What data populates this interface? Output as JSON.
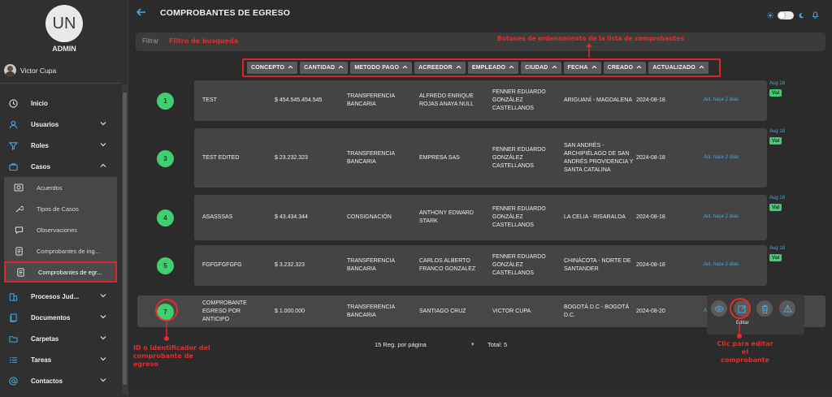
{
  "sidebar": {
    "avatar_initials": "UN",
    "role": "ADMIN",
    "user_name": "Victor Cupa",
    "items": [
      {
        "label": "Inicio"
      },
      {
        "label": "Usuarios"
      },
      {
        "label": "Roles"
      },
      {
        "label": "Casos"
      },
      {
        "label": "Procesos Jud..."
      },
      {
        "label": "Documentos"
      },
      {
        "label": "Carpetas"
      },
      {
        "label": "Tareas"
      },
      {
        "label": "Contactos"
      }
    ],
    "sub_items": [
      {
        "label": "Acuerdos"
      },
      {
        "label": "Tipos de Casos"
      },
      {
        "label": "Observaciones"
      },
      {
        "label": "Comprobantes de ing..."
      },
      {
        "label": "Comprobantes de egr..."
      }
    ]
  },
  "header": {
    "title": "COMPROBANTES DE EGRESO"
  },
  "filter": {
    "label": "Filtrar"
  },
  "annotations": {
    "filter": "Filtro de busqueda",
    "sort": "Botones de ordenamiento  de la lista de comprobantes",
    "id": "ID o identificador del comprobante de egreso",
    "edit": "Clic para editar el comprobante"
  },
  "sort_buttons": [
    "CONCEPTO",
    "CANTIDAD",
    "METODO PAGO",
    "ACREEDOR",
    "EMPLEADO",
    "CIUDAD",
    "FECHA",
    "CREADO",
    "ACTUALIZADO"
  ],
  "rows": [
    {
      "id": "1",
      "concepto": "TEST",
      "cantidad": "$ 454.545.454.545",
      "metodo": "TRANSFERENCIA BANCARIA",
      "acreedor": "ALFREDO ENRIQUE ROJAS ANAYA NULL",
      "empleado": "FENNER EDUARDO GONZÁLEZ CASTELLANOS",
      "ciudad": "ARIGUANÍ - MAGDALENA",
      "fecha": "2024-08-18",
      "actualizado": "Act. hace 2 días",
      "side_date": "Aug 18",
      "side_val": "Val"
    },
    {
      "id": "3",
      "concepto": "TEST EDITED",
      "cantidad": "$ 23.232.323",
      "metodo": "TRANSFERENCIA BANCARIA",
      "acreedor": "EMPRESA SAS",
      "empleado": "FENNER EDUARDO GONZÁLEZ CASTELLANOS",
      "ciudad": "SAN ANDRÉS - ARCHIPIÉLAGO DE SAN ANDRÉS PROVIDENCIA Y SANTA CATALINA",
      "fecha": "2024-08-18",
      "actualizado": "Act. hace 2 días",
      "side_date": "Aug 18",
      "side_val": "Val"
    },
    {
      "id": "4",
      "concepto": "ASASSSAS",
      "cantidad": "$ 43.434.344",
      "metodo": "CONSIGNACIÓN",
      "acreedor": "ANTHONY EDWARD STARK",
      "empleado": "FENNER EDUARDO GONZÁLEZ CASTELLANOS",
      "ciudad": "LA CELIA - RISARALDA",
      "fecha": "2024-08-18",
      "actualizado": "Act. hace 2 días",
      "side_date": "Aug 18",
      "side_val": "Val"
    },
    {
      "id": "5",
      "concepto": "FGFGFGFGFG",
      "cantidad": "$ 3.232.323",
      "metodo": "TRANSFERENCIA BANCARIA",
      "acreedor": "CARLOS ALBERTO FRANCO GONZALEZ",
      "empleado": "FENNER EDUARDO GONZÁLEZ CASTELLANOS",
      "ciudad": "CHINÁCOTA - NORTE DE SANTANDER",
      "fecha": "2024-08-18",
      "actualizado": "Act. hace 2 días",
      "side_date": "Aug 18",
      "side_val": "Val"
    },
    {
      "id": "7",
      "concepto": "COMPROBANTE EGRESO POR ANTICIPO",
      "cantidad": "$ 1.000.000",
      "metodo": "TRANSFERENCIA BANCARIA",
      "acreedor": "SANTIAGO CRUZ",
      "empleado": "VICTOR CUPA",
      "ciudad": "BOGOTÁ D.C - BOGOTÁ D.C.",
      "fecha": "2024-08-20",
      "actualizado": "A"
    }
  ],
  "actions": {
    "tooltip": "Editar"
  },
  "footer": {
    "per_page": "15 Reg. por página",
    "total": "Total: 5"
  }
}
